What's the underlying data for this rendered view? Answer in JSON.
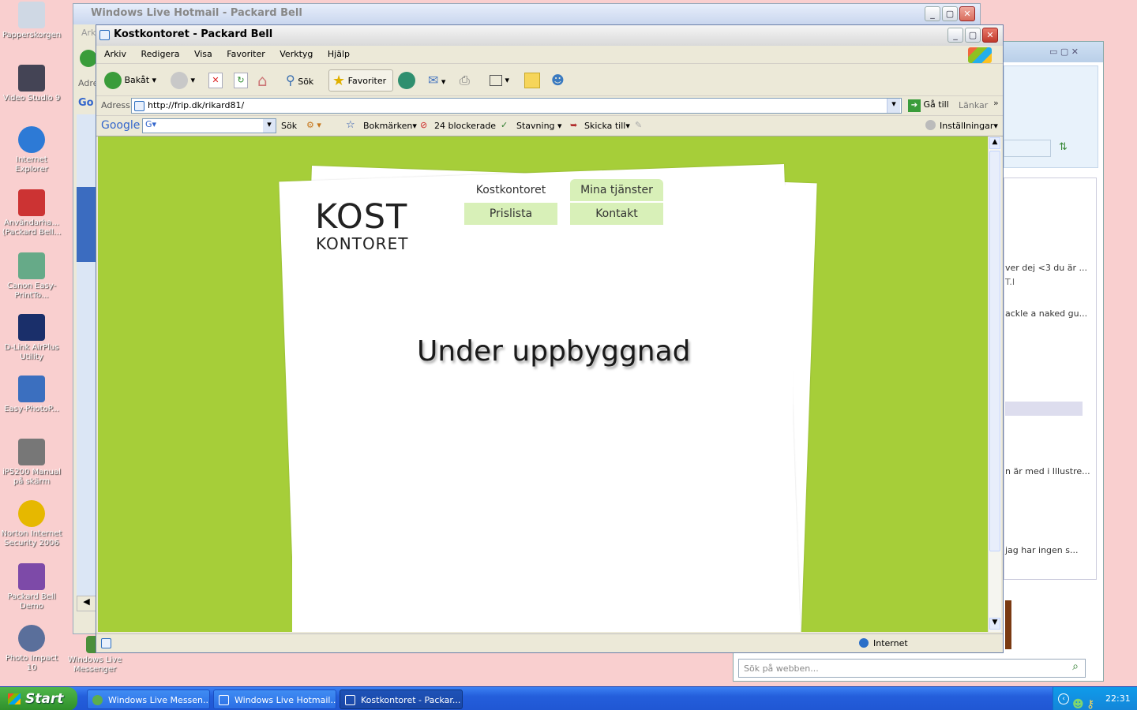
{
  "desktop": {
    "icons": [
      {
        "label": "Papperskorgen",
        "icon": "recycle-bin-icon"
      },
      {
        "label": "Video Studio 9",
        "icon": "video-studio-icon"
      },
      {
        "label": "Internet Explorer",
        "icon": "internet-explorer-icon"
      },
      {
        "label": "Användarha... (Packard Bell...",
        "icon": "user-guide-icon"
      },
      {
        "label": "Canon Easy-PrintTo...",
        "icon": "canon-icon"
      },
      {
        "label": "D-Link AirPlus Utility",
        "icon": "dlink-icon"
      },
      {
        "label": "Easy-PhotoP...",
        "icon": "easy-photo-icon"
      },
      {
        "label": "iP5200 Manual på skärm",
        "icon": "manual-icon"
      },
      {
        "label": "Norton Internet Security 2006",
        "icon": "norton-icon"
      },
      {
        "label": "Packard Bell Demo",
        "icon": "packard-bell-icon"
      },
      {
        "label": "Photo Impact 10",
        "icon": "photo-impact-icon"
      },
      {
        "label": "Windows Live Messenger",
        "icon": "messenger-icon"
      }
    ]
  },
  "hotmail_window": {
    "title": "Windows Live Hotmail - Packard Bell",
    "menu_fragment": "Ark",
    "addr_fragment": "Adre",
    "google_fragment": "Go"
  },
  "messenger_window": {
    "msg1": "ver dej <3 du är ...",
    "msg2": "T.I",
    "msg3": "ackle a naked gu...",
    "msg4": "n är med i Illustre...",
    "msg5": "jag har ingen s...",
    "search_placeholder": "Sök på webben..."
  },
  "ie": {
    "title": "Kostkontoret - Packard Bell",
    "menu": [
      "Arkiv",
      "Redigera",
      "Visa",
      "Favoriter",
      "Verktyg",
      "Hjälp"
    ],
    "toolbar": {
      "back": "Bakåt",
      "search": "Sök",
      "favorites": "Favoriter"
    },
    "address_label": "Adress",
    "url": "http://frip.dk/rikard81/",
    "go_label": "Gå till",
    "links_label": "Länkar",
    "google": {
      "logo": "Google",
      "search_label": "Sök",
      "bookmarks": "Bokmärken",
      "blocked": "24 blockerade",
      "spelling": "Stavning",
      "send_to": "Skicka till",
      "settings": "Inställningar"
    },
    "status_zone": "Internet"
  },
  "page": {
    "logo_line1": "KOST",
    "logo_line2": "KONTORET",
    "tabs": [
      "Kostkontoret",
      "Mina tjänster",
      "Prislista",
      "Kontakt"
    ],
    "heading": "Under uppbyggnad"
  },
  "taskbar": {
    "start": "Start",
    "tasks": [
      "Windows Live Messen...",
      "Windows Live Hotmail...",
      "Kostkontoret - Packar..."
    ],
    "clock": "22:31"
  },
  "colors": {
    "page_green": "#a6ce39",
    "tab_green": "#d8f0b8"
  }
}
